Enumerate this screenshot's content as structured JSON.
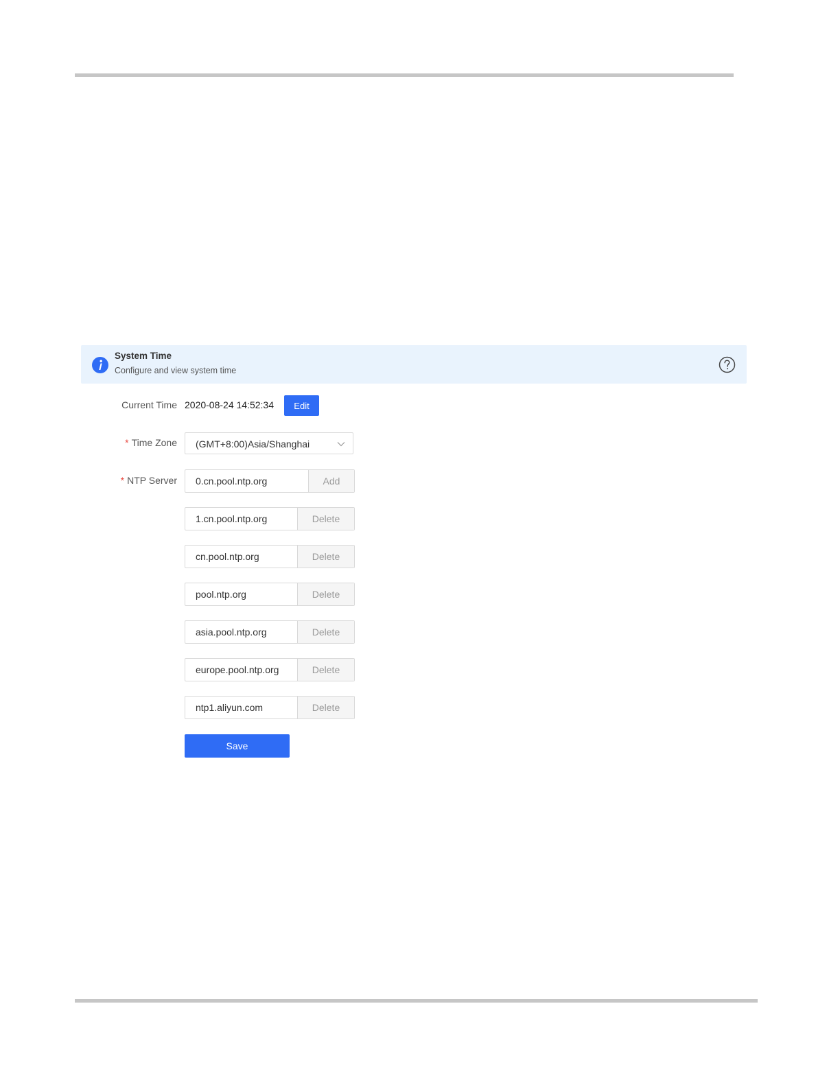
{
  "panel": {
    "title": "System Time",
    "description": "Configure and view system time",
    "info_icon": "info-icon",
    "help_icon": "question-circle-icon"
  },
  "form": {
    "current_time": {
      "label": "Current Time",
      "value": "2020-08-24 14:52:34",
      "edit_label": "Edit"
    },
    "time_zone": {
      "required_mark": "*",
      "label": "Time Zone",
      "selected": "(GMT+8:00)Asia/Shanghai",
      "dropdown_icon": "chevron-down-icon"
    },
    "ntp": {
      "required_mark": "*",
      "label": "NTP Server",
      "add_label": "Add",
      "delete_label": "Delete",
      "servers": [
        "0.cn.pool.ntp.org",
        "1.cn.pool.ntp.org",
        "cn.pool.ntp.org",
        "pool.ntp.org",
        "asia.pool.ntp.org",
        "europe.pool.ntp.org",
        "ntp1.aliyun.com"
      ]
    },
    "save_label": "Save"
  },
  "colors": {
    "primary": "#2f6cf5",
    "banner_bg": "#e9f3fd",
    "required": "#e8483f",
    "divider": "#c6c6c6"
  }
}
